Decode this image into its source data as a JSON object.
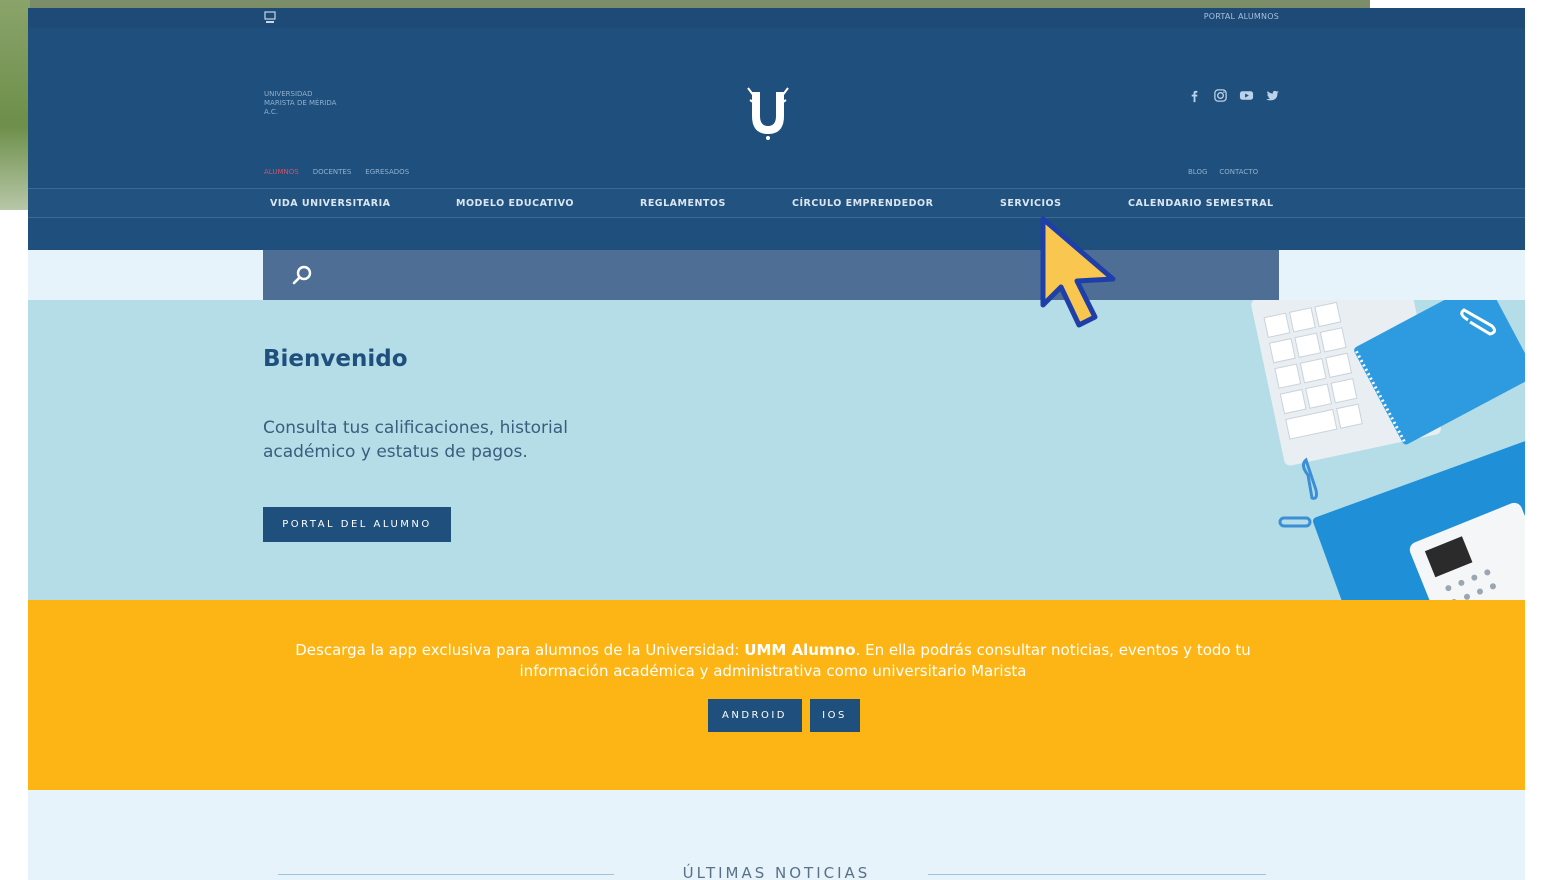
{
  "topbar": {
    "portal_link": "PORTAL ALUMNOS"
  },
  "header": {
    "brand_text": "UNIVERSIDAD MARISTA DE MÉRIDA A.C.",
    "audience": [
      {
        "label": "ALUMNOS",
        "active": true
      },
      {
        "label": "DOCENTES",
        "active": false
      },
      {
        "label": "EGRESADOS",
        "active": false
      }
    ],
    "utility_links": [
      "BLOG",
      "CONTACTO"
    ],
    "social_icons": [
      "facebook-icon",
      "instagram-icon",
      "youtube-icon",
      "twitter-icon"
    ]
  },
  "nav": {
    "items": [
      "VIDA UNIVERSITARIA",
      "MODELO EDUCATIVO",
      "REGLAMENTOS",
      "CÍRCULO EMPRENDEDOR",
      "SERVICIOS",
      "CALENDARIO SEMESTRAL"
    ]
  },
  "search": {
    "value": "",
    "placeholder": ""
  },
  "hero": {
    "title": "Bienvenido",
    "text": "Consulta tus calificaciones, historial académico y estatus de pagos.",
    "button": "PORTAL DEL ALUMNO"
  },
  "band": {
    "text_before": "Descarga la app exclusiva para alumnos de la Universidad: ",
    "app_name": "UMM Alumno",
    "text_after": ". En ella podrás consultar noticias, eventos y todo tu información académica y administrativa como universitario Marista",
    "buttons": [
      "ANDROID",
      "IOS"
    ]
  },
  "news": {
    "title": "ÚLTIMAS NOTICIAS"
  },
  "colors": {
    "navy": "#1f4f7c",
    "hero_bg": "#b5dde7",
    "band_bg": "#fdb515",
    "page_bg": "#e7f3fa",
    "active_link": "#c9566c",
    "cursor_fill": "#f9c74f",
    "cursor_stroke": "#1e3fa8"
  }
}
